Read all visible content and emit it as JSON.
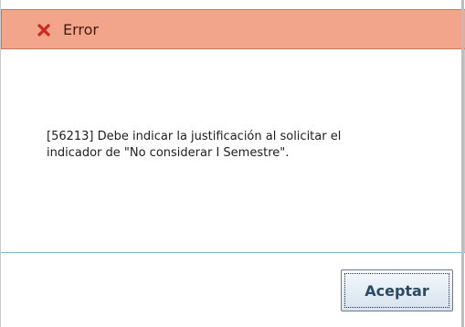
{
  "dialog": {
    "title": "Error",
    "title_icon": "close-x-icon",
    "message_line1": "[56213] Debe indicar la justificación al solicitar el",
    "message_line2": "indicador de \"No considerar I Semestre\".",
    "ok_label": "Aceptar"
  },
  "colors": {
    "titlebar": "#f3a58c",
    "icon": "#d0281c",
    "separator": "#7fbad3"
  }
}
